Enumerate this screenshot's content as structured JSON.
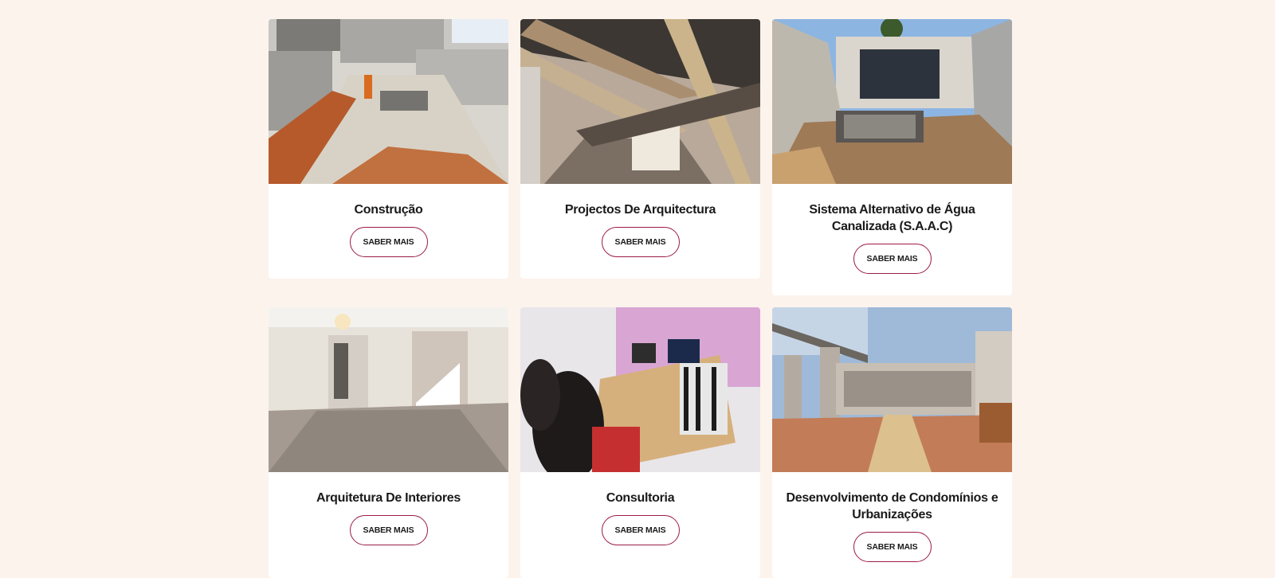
{
  "services": [
    {
      "title": "Construção",
      "button": "SABER MAIS",
      "image": "construction-site-photo"
    },
    {
      "title": "Projectos De Arquitectura",
      "button": "SABER MAIS",
      "image": "ceiling-formwork-photo"
    },
    {
      "title": "Sistema Alternativo de Água Canalizada (S.A.A.C)",
      "button": "SABER MAIS",
      "image": "water-tank-excavation-photo"
    },
    {
      "title": "Arquitetura De Interiores",
      "button": "SABER MAIS",
      "image": "interior-room-photo"
    },
    {
      "title": "Consultoria",
      "button": "SABER MAIS",
      "image": "meeting-room-photo"
    },
    {
      "title": "Desenvolvimento de Condomínios e Urbanizações",
      "button": "SABER MAIS",
      "image": "condominium-courtyard-photo"
    }
  ],
  "colors": {
    "background": "#fcf3ec",
    "button_border": "#9b1c43",
    "card": "#ffffff"
  }
}
